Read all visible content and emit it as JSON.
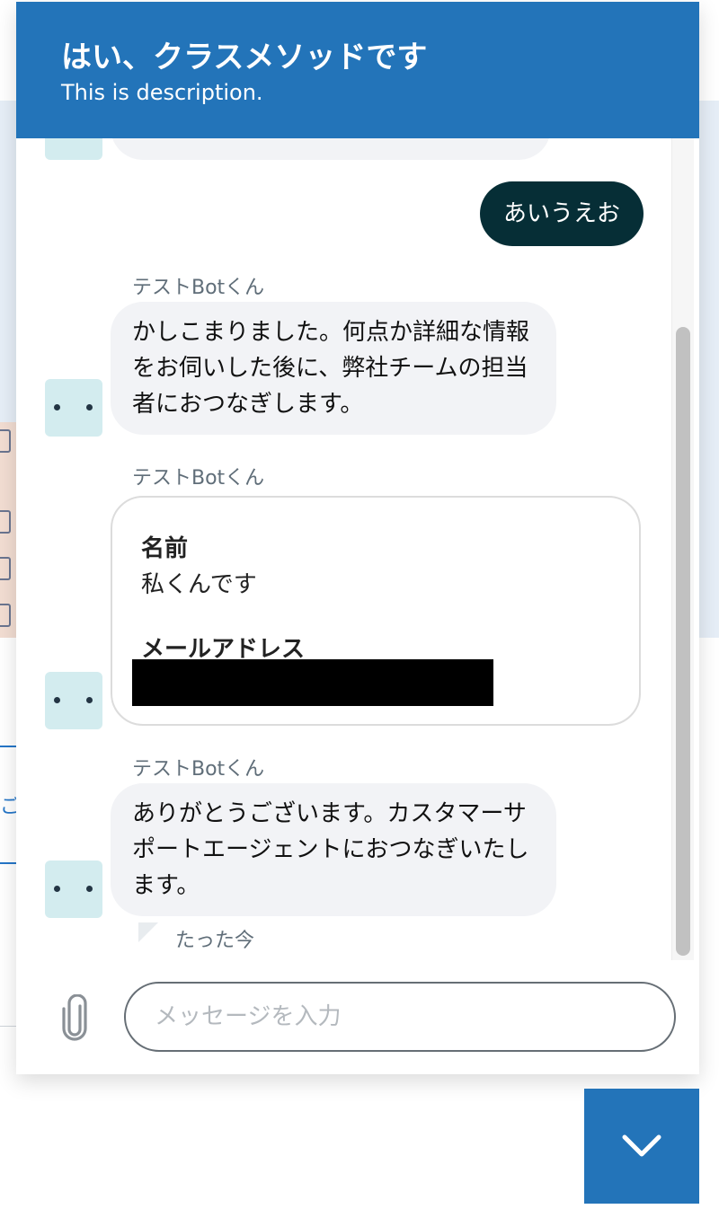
{
  "header": {
    "title": "はい、クラスメソッドです",
    "description": "This is description."
  },
  "messages": {
    "user": {
      "text": "あいうえお"
    },
    "bot1": {
      "sender": "テストBotくん",
      "text": "かしこまりました。何点か詳細な情報をお伺いした後に、弊社チームの担当者におつなぎします。"
    },
    "bot2": {
      "sender": "テストBotくん",
      "name_label": "名前",
      "name_value": "私くんです",
      "email_label": "メールアドレス"
    },
    "bot3": {
      "sender": "テストBotくん",
      "text": "ありがとうございます。カスタマーサポートエージェントにおつなぎいたします。",
      "timestamp": "たった今"
    }
  },
  "composer": {
    "placeholder": "メッセージを入力",
    "attach_icon": "paperclip-icon"
  },
  "toggle": {
    "icon": "chevron-down-icon"
  },
  "colors": {
    "brand": "#2374b9",
    "user_bubble": "#062e36",
    "bot_bubble": "#f2f3f6",
    "avatar": "#d3ecef"
  }
}
